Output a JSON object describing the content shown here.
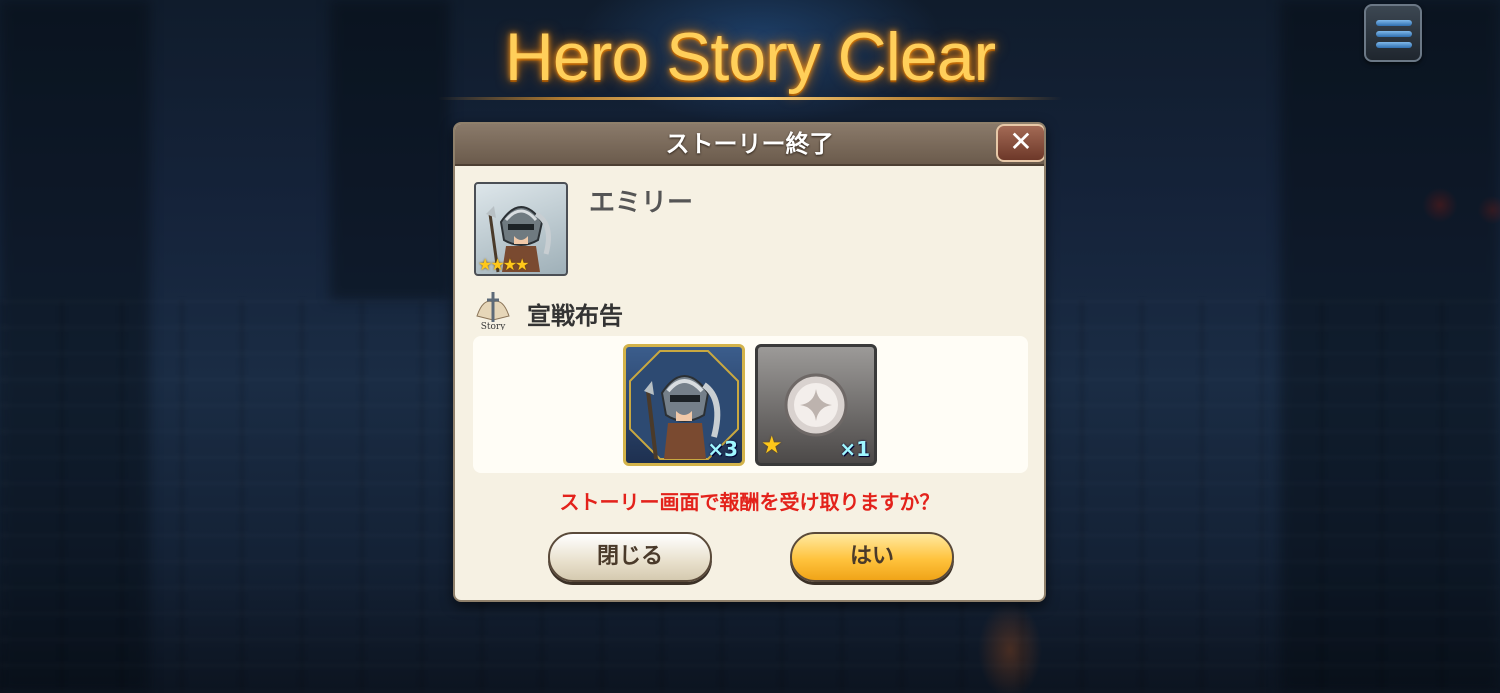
{
  "screen_title": "Hero Story Clear",
  "dialog": {
    "title": "ストーリー終了",
    "close_icon": "✕",
    "hero": {
      "name": "エミリー",
      "rarity_stars": "★★★★"
    },
    "story": {
      "icon_label": "Story",
      "title": "宣戦布告"
    },
    "rewards": [
      {
        "icon": "hero-medal-icon",
        "quantity": "×3"
      },
      {
        "icon": "silver-orb-icon",
        "rarity_star": "★",
        "quantity": "×1"
      }
    ],
    "question": "ストーリー画面で報酬を受け取りますか？",
    "close_button": "閉じる",
    "yes_button": "はい"
  },
  "colors": {
    "title_glow": "#ffcf5a",
    "question_text": "#e3221b",
    "yes_button": "#ffc33d"
  }
}
